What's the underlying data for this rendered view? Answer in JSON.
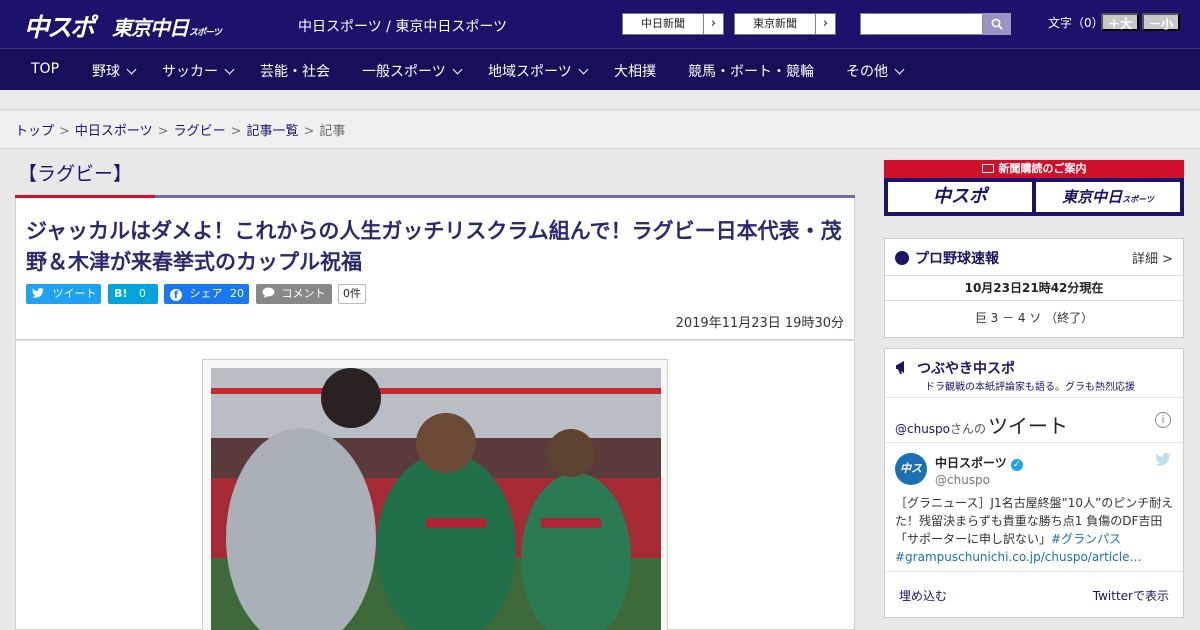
{
  "header": {
    "logo_main": "中スポ",
    "logo_tokyo": "東京中日",
    "logo_tokyo_small": "スポーツ",
    "site_names": "中日スポーツ / 東京中日スポーツ",
    "ext_links": [
      {
        "label": "中日新聞",
        "arrow": "›"
      },
      {
        "label": "東京新聞",
        "arrow": "›"
      }
    ],
    "search_placeholder": "",
    "font_size_label": "文字（0）",
    "font_larger": "＋大",
    "font_smaller": "－小"
  },
  "nav": {
    "items": [
      {
        "label": "TOP"
      },
      {
        "label": "野球"
      },
      {
        "label": "サッカー"
      },
      {
        "label": "芸能・社会"
      },
      {
        "label": "一般スポーツ"
      },
      {
        "label": "地域スポーツ"
      },
      {
        "label": "大相撲"
      },
      {
        "label": "競馬・ボート・競輪"
      },
      {
        "label": "その他"
      }
    ]
  },
  "breadcrumb": {
    "items": [
      "トップ",
      "中日スポーツ",
      "ラグビー",
      "記事一覧"
    ],
    "current": "記事",
    "separator": ">"
  },
  "article": {
    "category": "【ラグビー】",
    "title": "ジャッカルはダメよ！これからの人生ガッチリスクラム組んで！ラグビー日本代表・茂野＆木津が来春挙式のカップル祝福",
    "share": {
      "tweet_label": "ツイート",
      "hatena_icon": "B!",
      "hatena_count": "0",
      "facebook_label": "シェア",
      "facebook_count": "20",
      "comment_label": "コメント",
      "comment_count": "0件"
    },
    "date": "2019年11月23日 19時30分"
  },
  "sidebar": {
    "subscribe": {
      "header": "新聞購読のご案内",
      "paper1": "中スポ",
      "paper2": "東京中日",
      "paper2_small": "スポーツ"
    },
    "baseball": {
      "title": "プロ野球速報",
      "more": "詳細 >",
      "time": "10月23日21時42分現在",
      "score": "巨 3 － 4 ソ （終了）"
    },
    "tweets": {
      "title": "つぶやき中スポ",
      "subtitle": "ドラ観戦の本紙評論家も語る。グラも熱烈応援",
      "handle": "@chuspo",
      "handle_suffix": "さんの",
      "tweets_word": "ツイート",
      "avatar_text": "中スポ",
      "name": "中日スポーツ",
      "user": "@chuspo",
      "text": "［グラニュース］J1名古屋終盤”10人”のピンチ耐えた！残留決まらずも貴重な勝ち点1 負傷のDF吉田「サポーターに申し訳ない」",
      "hashtag": "#グランパス",
      "link": "#grampuschunichi.co.jp/chuspo/article…",
      "embed": "埋め込む",
      "view": "Twitterで表示"
    }
  },
  "colors": {
    "brand_navy": "#1b136b",
    "accent_red": "#d0102a",
    "twitter_blue": "#1da1f2",
    "facebook_blue": "#1877f2",
    "hatena_blue": "#00a4de"
  }
}
